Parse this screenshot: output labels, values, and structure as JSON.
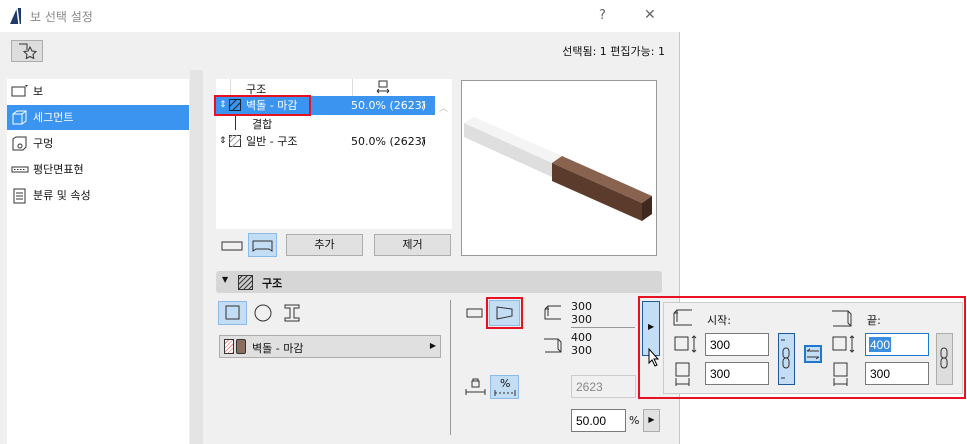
{
  "window": {
    "title": "보 선택 설정",
    "help": "?",
    "close": "✕"
  },
  "header": {
    "selection_status": "선택됨: 1 편집가능: 1"
  },
  "sidebar": {
    "items": [
      {
        "label": "보"
      },
      {
        "label": "세그먼트",
        "selected": true
      },
      {
        "label": "구멍"
      },
      {
        "label": "평단면표현"
      },
      {
        "label": "분류 및 속성"
      }
    ]
  },
  "segments_table": {
    "column_header": "구조",
    "rows": [
      {
        "name": "벽돌 - 마감",
        "value": "50.0% (2623)",
        "selected": true
      },
      {
        "name": "결합",
        "connector": true
      },
      {
        "name": "일반 - 구조",
        "value": "50.0% (2623)"
      }
    ]
  },
  "buttons": {
    "add": "추가",
    "remove": "제거"
  },
  "section": {
    "title": "구조",
    "material": "벽돌 - 마감"
  },
  "dims": {
    "start_top": "300",
    "start_bottom": "300",
    "end_top": "400",
    "end_bottom": "300"
  },
  "length_value": "2623",
  "percent_value": "50.00",
  "percent_unit": "%",
  "popup": {
    "start_label": "시작:",
    "end_label": "끝:",
    "start_height": "300",
    "start_width": "300",
    "end_height": "400",
    "end_width": "300"
  },
  "colors": {
    "accent": "#3a94f0",
    "highlight": "#e81123",
    "brick": "#6b4a3a"
  }
}
